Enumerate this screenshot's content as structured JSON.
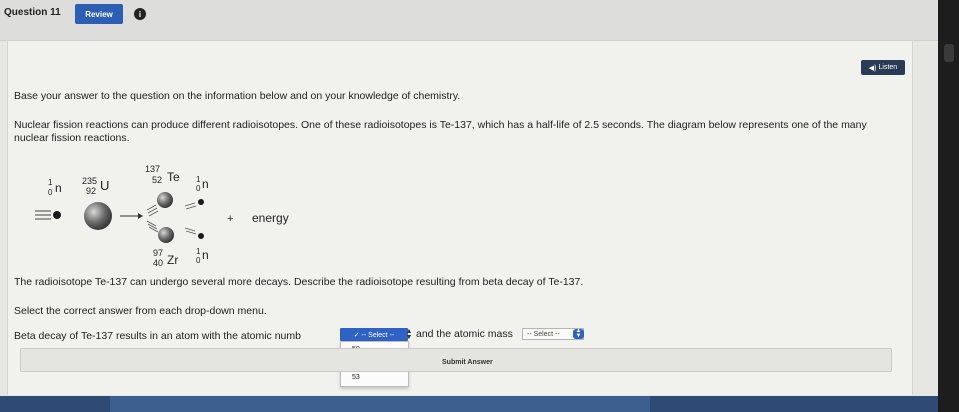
{
  "header": {
    "question_label": "Question 11",
    "review_label": "Review",
    "info_icon": "i"
  },
  "listen": {
    "icon": "speaker-icon",
    "glyph": "◀)",
    "label": "Listen"
  },
  "content": {
    "intro": "Base your answer to the question on the information below and on your knowledge of chemistry.",
    "para1": "Nuclear fission reactions can produce different radioisotopes. One of these radioisotopes is Te-137, which has a half-life of 2.5 seconds. The diagram below represents one of the many nuclear fission reactions.",
    "para2": "The radioisotope Te-137 can undergo several more decays. Describe the radioisotope resulting from beta decay of Te-137.",
    "instruction": "Select the correct answer from each drop-down menu.",
    "beta_prefix": "Beta decay of Te-137 results in an atom with the atomic numb",
    "mass_label": "and the atomic mass"
  },
  "diagram": {
    "neutron_in": {
      "mass": "1",
      "atomic": "0",
      "symbol": "n"
    },
    "uranium": {
      "mass": "235",
      "atomic": "92",
      "symbol": "U"
    },
    "tellurium": {
      "mass": "137",
      "atomic": "52",
      "symbol": "Te"
    },
    "zirconium": {
      "mass": "97",
      "atomic": "40",
      "symbol": "Zr"
    },
    "neutron_top": {
      "mass": "1",
      "atomic": "0",
      "symbol": "n"
    },
    "neutron_bottom": {
      "mass": "1",
      "atomic": "0",
      "symbol": "n"
    },
    "plus": "+",
    "energy": "energy"
  },
  "atomic_dropdown": {
    "selected": "✓ -- Select --",
    "options": [
      "50",
      "52",
      "53"
    ]
  },
  "mass_dropdown": {
    "selected": "-- Select --"
  },
  "submit_label": "Submit Answer",
  "colors": {
    "accent": "#2f62c4",
    "review": "#2c5fb4",
    "listen": "#2a3b55",
    "bottom_bar": "#2d4b75"
  }
}
